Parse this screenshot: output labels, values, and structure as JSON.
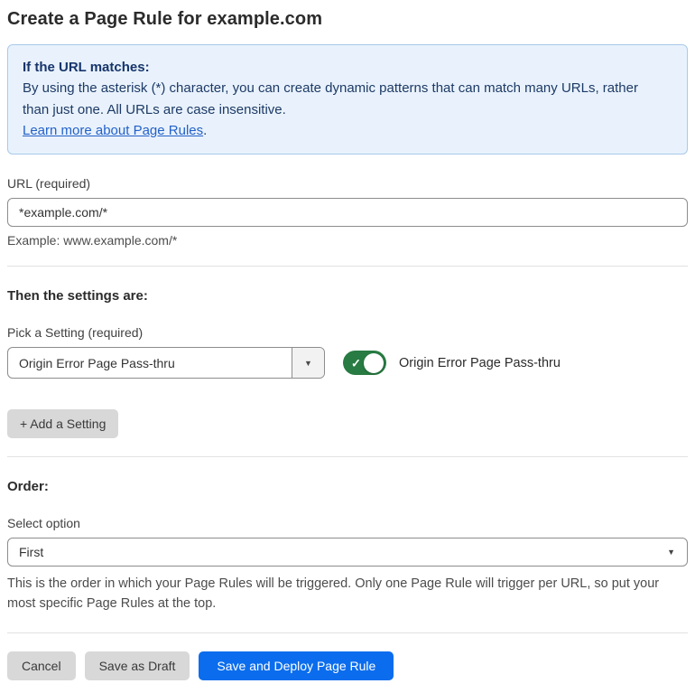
{
  "page": {
    "title": "Create a Page Rule for example.com"
  },
  "info_box": {
    "heading": "If the URL matches:",
    "body": "By using the asterisk (*) character, you can create dynamic patterns that can match many URLs, rather than just one. All URLs are case insensitive.",
    "link_label": "Learn more about Page Rules",
    "link_suffix": "."
  },
  "url_section": {
    "label": "URL (required)",
    "value": "*example.com/*",
    "helper": "Example: www.example.com/*"
  },
  "settings_section": {
    "heading": "Then the settings are:",
    "picker_label": "Pick a Setting (required)",
    "selected_setting": "Origin Error Page Pass-thru",
    "toggle": {
      "state": "on",
      "label": "Origin Error Page Pass-thru"
    },
    "add_button_label": "+ Add a Setting"
  },
  "order_section": {
    "heading": "Order:",
    "select_label": "Select option",
    "selected_option": "First",
    "helper": "This is the order in which your Page Rules will be triggered. Only one Page Rule will trigger per URL, so put your most specific Page Rules at the top."
  },
  "footer": {
    "cancel_label": "Cancel",
    "save_draft_label": "Save as Draft",
    "save_deploy_label": "Save and Deploy Page Rule"
  },
  "icons": {
    "dropdown_caret": "▼",
    "toggle_check": "✓"
  },
  "colors": {
    "primary_blue": "#0b6ded",
    "toggle_green": "#287b42",
    "info_bg": "#e9f2fc",
    "info_border": "#a9c9e9",
    "info_text": "#1d3a66",
    "link_blue": "#2361c9",
    "button_gray": "#d8d8d8",
    "divider": "#e2e2e2"
  }
}
